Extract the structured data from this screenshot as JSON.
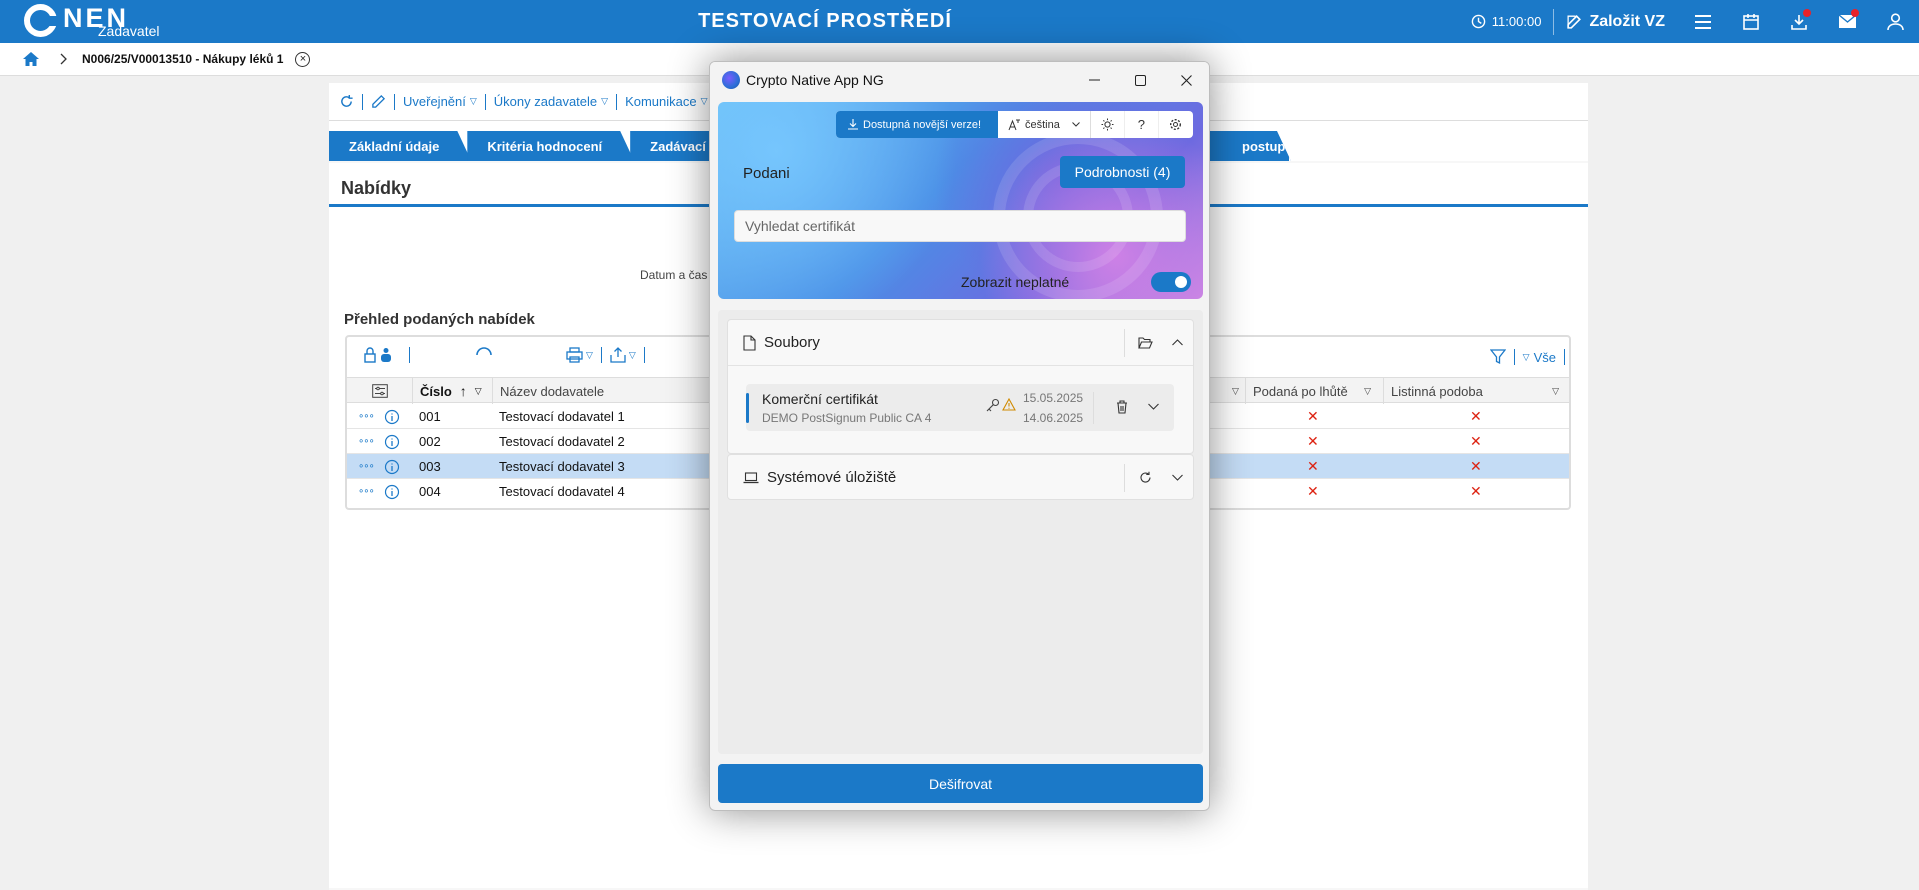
{
  "topbar": {
    "logo": "NEN",
    "logo_sub": "Zadavatel",
    "title": "TESTOVACÍ PROSTŘEDÍ",
    "time": "11:00:00",
    "create_label": "Založit VZ"
  },
  "breadcrumb": {
    "text": "N006/25/V00013510 - Nákupy léků 1",
    "close": "×"
  },
  "toolbar": {
    "items": [
      "Uveřejnění",
      "Úkony zadavatele",
      "Komunikace"
    ],
    "caret": "▽"
  },
  "tabs": [
    "Základní údaje",
    "Kritéria hodnocení",
    "Zadávací po",
    "postupu"
  ],
  "section": {
    "title": "Nabídky",
    "datum_label": "Datum a čas",
    "subtitle": "Přehled podaných nabídek"
  },
  "grid": {
    "columns": [
      "Číslo",
      "Název dodavatele",
      "Podaná po lhůtě",
      "Listinná podoba"
    ],
    "sort_arrow": "↑",
    "filter_caret": "▽",
    "all_label": "Vše",
    "rows": [
      {
        "num": "001",
        "name": "Testovací dodavatel 1",
        "late": "✕",
        "paper": "✕"
      },
      {
        "num": "002",
        "name": "Testovací dodavatel 2",
        "late": "✕",
        "paper": "✕"
      },
      {
        "num": "003",
        "name": "Testovací dodavatel 3",
        "late": "✕",
        "paper": "✕"
      },
      {
        "num": "004",
        "name": "Testovací dodavatel 4",
        "late": "✕",
        "paper": "✕"
      }
    ],
    "row_actions": "∘∘∘",
    "selected_row": 2
  },
  "modal": {
    "title": "Crypto Native App NG",
    "update_label": "Dostupná novější verze!",
    "language": "čeština",
    "help": "?",
    "podani": "Podani",
    "details_button": "Podrobnosti (4)",
    "search_placeholder": "Vyhledat certifikát",
    "show_invalid_label": "Zobrazit neplatné",
    "show_invalid": true,
    "files_label": "Soubory",
    "certificate": {
      "name": "Komerční certifikát",
      "issuer": "DEMO PostSignum Public CA 4",
      "valid_from": "15.05.2025",
      "valid_to": "14.06.2025"
    },
    "system_store_label": "Systémové úložiště",
    "decrypt_button": "Dešifrovat"
  },
  "colors": {
    "primary": "#1b79c8",
    "error": "#dd1111"
  }
}
